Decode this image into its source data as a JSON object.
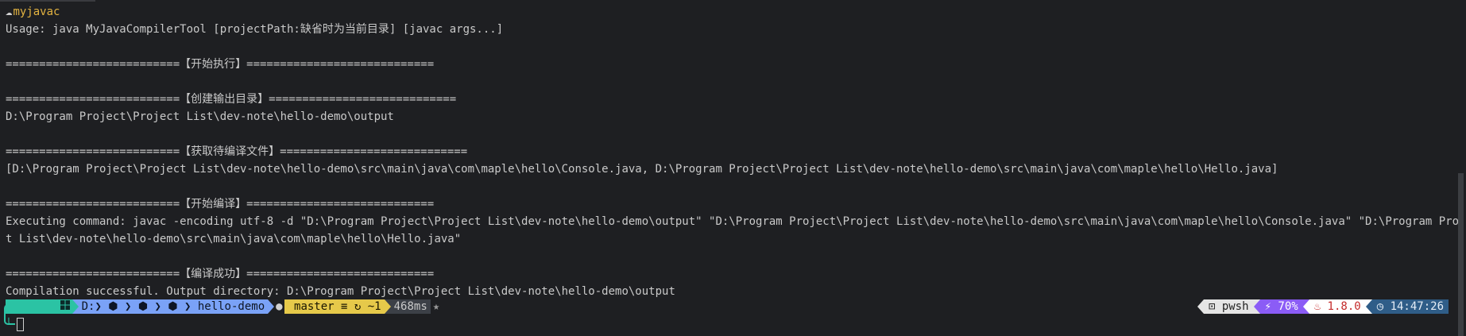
{
  "terminal": {
    "title": "myjavac",
    "lines": [
      "Usage: java MyJavaCompilerTool [projectPath:缺省时为当前目录] [javac args...]",
      "",
      "==========================【开始执行】============================",
      "",
      "==========================【创建输出目录】============================",
      "D:\\Program Project\\Project List\\dev-note\\hello-demo\\output",
      "",
      "==========================【获取待编译文件】============================",
      "[D:\\Program Project\\Project List\\dev-note\\hello-demo\\src\\main\\java\\com\\maple\\hello\\Console.java, D:\\Program Project\\Project List\\dev-note\\hello-demo\\src\\main\\java\\com\\maple\\hello\\Hello.java]",
      "",
      "==========================【开始编译】============================",
      "Executing command: javac -encoding utf-8 -d \"D:\\Program Project\\Project List\\dev-note\\hello-demo\\output\" \"D:\\Program Project\\Project List\\dev-note\\hello-demo\\src\\main\\java\\com\\maple\\hello\\Console.java\" \"D:\\Program Project\\Projec",
      "t List\\dev-note\\hello-demo\\src\\main\\java\\com\\maple\\hello\\Hello.java\"",
      "",
      "==========================【编译成功】============================",
      "Compilation successful. Output directory: D:\\Program Project\\Project List\\dev-note\\hello-demo\\output"
    ]
  },
  "prompt": {
    "os_icon": "windows-icon",
    "drive": "D:",
    "path_mid_icons": [
      "folder-icon",
      "folder-icon",
      "folder-icon"
    ],
    "folder": "hello-demo",
    "git_icon": "github-icon",
    "branch": "master",
    "git_status": "≡ ↻ ~1",
    "duration": "468ms",
    "right": {
      "shell": "pwsh",
      "battery": "70%",
      "java": "1.8.0",
      "time": "14:47:26"
    }
  },
  "colors": {
    "background": "#1e1f22",
    "text": "#c9c9c9",
    "title": "#e3b341",
    "os_segment": "#2bc3a4",
    "path_segment": "#7aa2f7",
    "git_segment": "#e6c94a",
    "battery_segment": "#8b5cf6",
    "clock_segment": "#2f5d88"
  }
}
